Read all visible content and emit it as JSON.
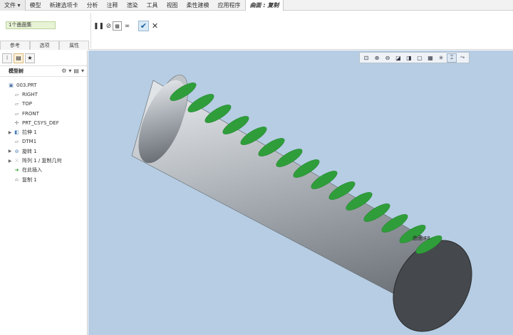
{
  "menubar": {
    "file": "文件",
    "items": [
      "模型",
      "新建选项卡",
      "分析",
      "注释",
      "渲染",
      "工具",
      "视图",
      "柔性建模",
      "应用程序"
    ],
    "active_tab": "曲面 : 复制"
  },
  "ribbon": {
    "selection_box": "1个曲面集",
    "sub_tabs": [
      "参考",
      "选项",
      "属性"
    ]
  },
  "left_panel": {
    "tree_title": "模型树",
    "tree": [
      {
        "label": "003.PRT",
        "icon": "part-icon",
        "expand": ""
      },
      {
        "label": "RIGHT",
        "icon": "datum-plane-icon",
        "expand": ""
      },
      {
        "label": "TOP",
        "icon": "datum-plane-icon",
        "expand": ""
      },
      {
        "label": "FRONT",
        "icon": "datum-plane-icon",
        "expand": ""
      },
      {
        "label": "PRT_CSYS_DEF",
        "icon": "csys-icon",
        "expand": ""
      },
      {
        "label": "拉伸 1",
        "icon": "extrude-icon",
        "expand": "▶"
      },
      {
        "label": "DTM1",
        "icon": "datum-plane-icon",
        "expand": ""
      },
      {
        "label": "旋转 1",
        "icon": "revolve-icon",
        "expand": "▶"
      },
      {
        "label": "阵列 1 / 复制几何",
        "icon": "pattern-icon",
        "expand": "▶"
      },
      {
        "label": "在此插入",
        "icon": "insert-here-icon",
        "expand": ""
      },
      {
        "label": "复制 1",
        "icon": "copy-surface-icon",
        "expand": ""
      }
    ]
  },
  "viewport": {
    "feature_label": "曲面:F8"
  },
  "colors": {
    "viewport_bg": "#b6cde3",
    "slot_green": "#2f9e3a",
    "cylinder_body": "#9aa1a8"
  }
}
